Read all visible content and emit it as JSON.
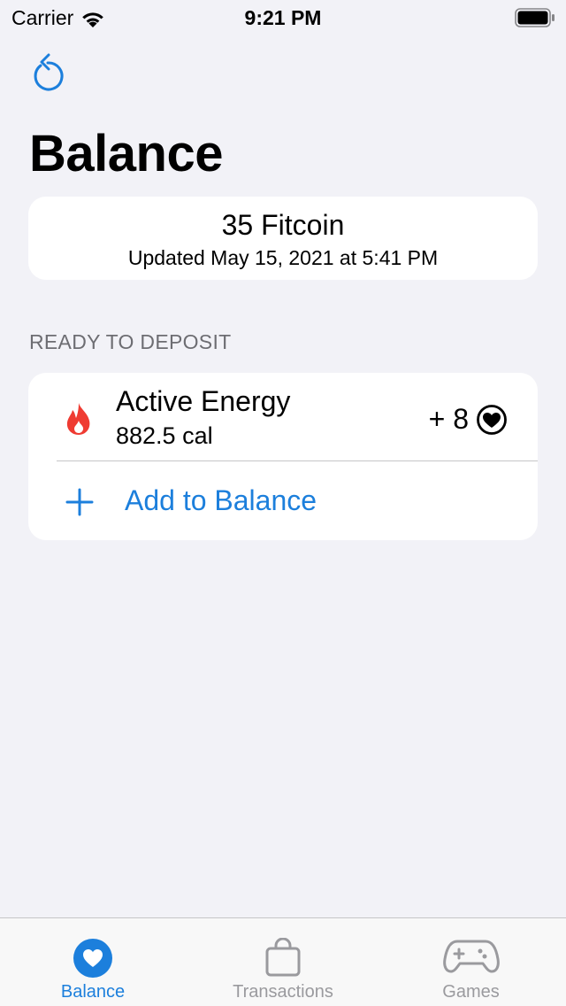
{
  "status_bar": {
    "carrier": "Carrier",
    "time": "9:21 PM"
  },
  "page": {
    "title": "Balance"
  },
  "balance": {
    "amount": "35 Fitcoin",
    "updated": "Updated May 15, 2021 at 5:41 PM"
  },
  "deposit": {
    "section_title": "READY TO DEPOSIT",
    "item": {
      "title": "Active Energy",
      "value": "882.5 cal",
      "reward": "+ 8",
      "icon": "flame-icon",
      "reward_icon": "heart-coin-icon"
    },
    "add_label": "Add to Balance"
  },
  "tabs": [
    {
      "label": "Balance",
      "icon": "heart-icon",
      "active": true
    },
    {
      "label": "Transactions",
      "icon": "bag-icon",
      "active": false
    },
    {
      "label": "Games",
      "icon": "gamecontroller-icon",
      "active": false
    }
  ],
  "colors": {
    "accent": "#1c7fdc",
    "flame": "#ef3b32",
    "background": "#f2f2f7",
    "inactive_tab": "#9a9a9e"
  }
}
